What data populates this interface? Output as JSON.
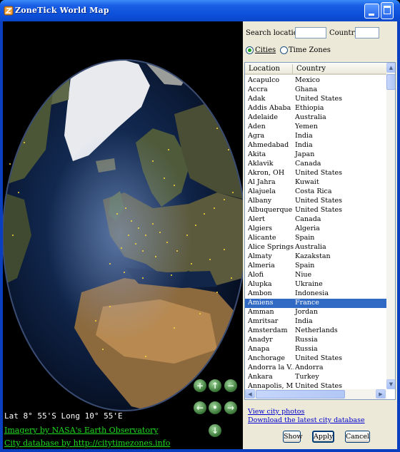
{
  "window": {
    "title": "ZoneTick World Map"
  },
  "map": {
    "coordinates": "Lat  8° 55'S  Long  10° 55'E",
    "credit_imagery": "Imagery by NASA's Earth Observatory",
    "credit_city_db": "City database by http://citytimezones.info",
    "nav_buttons": [
      "zoom-in",
      "pan-up",
      "zoom-out",
      "pan-left",
      "center",
      "pan-right",
      "pan-down"
    ]
  },
  "search": {
    "location_label": "Search location:",
    "location_value": "",
    "country_label": "Country:",
    "country_value": ""
  },
  "mode": {
    "cities_label": "Cities",
    "timezones_label": "Time Zones",
    "selected": "Cities"
  },
  "list": {
    "headers": {
      "location": "Location",
      "country": "Country"
    },
    "selected_index": 23,
    "rows": [
      {
        "location": "Acapulco",
        "country": "Mexico"
      },
      {
        "location": "Accra",
        "country": "Ghana"
      },
      {
        "location": "Adak",
        "country": "United States"
      },
      {
        "location": "Addis Ababa",
        "country": "Ethiopia"
      },
      {
        "location": "Adelaide",
        "country": "Australia"
      },
      {
        "location": "Aden",
        "country": "Yemen"
      },
      {
        "location": "Agra",
        "country": "India"
      },
      {
        "location": "Ahmedabad",
        "country": "India"
      },
      {
        "location": "Akita",
        "country": "Japan"
      },
      {
        "location": "Aklavik",
        "country": "Canada"
      },
      {
        "location": "Akron, OH",
        "country": "United States"
      },
      {
        "location": "Al Jahra",
        "country": "Kuwait"
      },
      {
        "location": "Alajuela",
        "country": "Costa Rica"
      },
      {
        "location": "Albany",
        "country": "United States"
      },
      {
        "location": "Albuquerque",
        "country": "United States"
      },
      {
        "location": "Alert",
        "country": "Canada"
      },
      {
        "location": "Algiers",
        "country": "Algeria"
      },
      {
        "location": "Alicante",
        "country": "Spain"
      },
      {
        "location": "Alice Springs",
        "country": "Australia"
      },
      {
        "location": "Almaty",
        "country": "Kazakstan"
      },
      {
        "location": "Almeria",
        "country": "Spain"
      },
      {
        "location": "Alofi",
        "country": "Niue"
      },
      {
        "location": "Alupka",
        "country": "Ukraine"
      },
      {
        "location": "Ambon",
        "country": "Indonesia"
      },
      {
        "location": "Amiens",
        "country": "France"
      },
      {
        "location": "Amman",
        "country": "Jordan"
      },
      {
        "location": "Amritsar",
        "country": "India"
      },
      {
        "location": "Amsterdam",
        "country": "Netherlands"
      },
      {
        "location": "Anadyr",
        "country": "Russia"
      },
      {
        "location": "Anapa",
        "country": "Russia"
      },
      {
        "location": "Anchorage",
        "country": "United States"
      },
      {
        "location": "Andorra la V...",
        "country": "Andorra"
      },
      {
        "location": "Ankara",
        "country": "Turkey"
      },
      {
        "location": "Annapolis, MD",
        "country": "United States"
      }
    ]
  },
  "links": {
    "city_photos": "View city photos",
    "download_db": "Download the latest city database"
  },
  "buttons": {
    "show": "Show",
    "apply": "Apply",
    "cancel": "Cancel"
  },
  "colors": {
    "title_bar": "#0c4fd8",
    "selection": "#316ac5",
    "credit_link": "#1fdc1f",
    "panel_bg": "#ece9d8"
  }
}
